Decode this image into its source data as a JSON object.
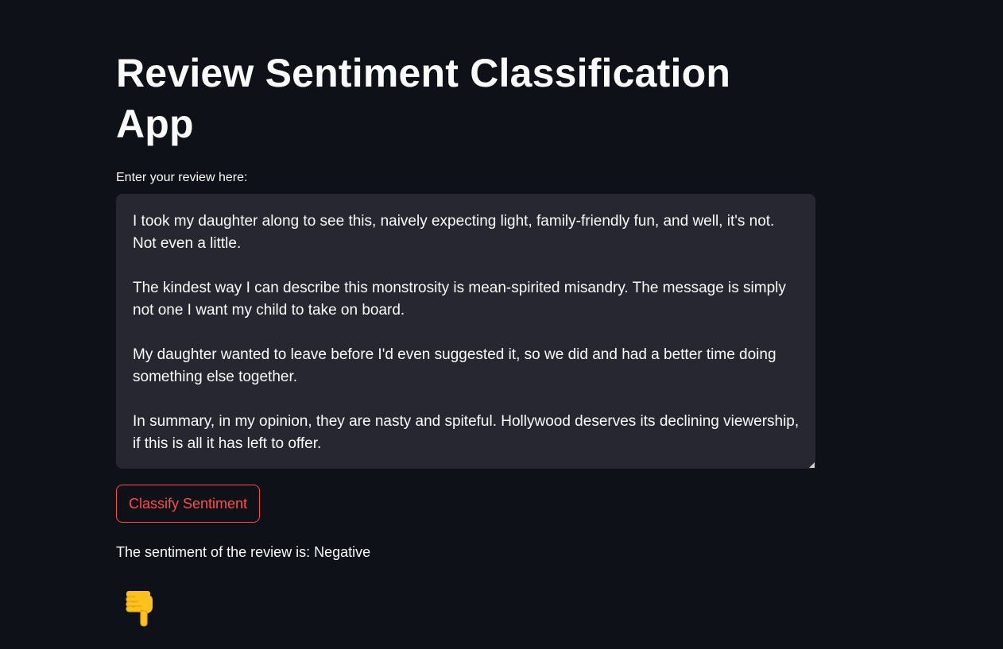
{
  "app": {
    "title": "Review Sentiment Classification App"
  },
  "review_input": {
    "label": "Enter your review here:",
    "value": "I took my daughter along to see this, naively expecting light, family-friendly fun, and well, it's not. Not even a little.\n\nThe kindest way I can describe this monstrosity is mean-spirited misandry. The message is simply not one I want my child to take on board.\n\nMy daughter wanted to leave before I'd even suggested it, so we did and had a better time doing something else together.\n\nIn summary, in my opinion, they are nasty and spiteful. Hollywood deserves its declining viewership, if this is all it has left to offer."
  },
  "classify_button": {
    "label": "Classify Sentiment",
    "color": "#ff4b4b"
  },
  "result": {
    "text": "The sentiment of the review is: Negative",
    "icon": "thumbs-down-icon"
  },
  "theme": {
    "background": "#0e1117",
    "input_background": "#262730",
    "text": "#fafafa",
    "accent": "#ff4b4b",
    "emoji_yellow": "#fcc21b"
  }
}
